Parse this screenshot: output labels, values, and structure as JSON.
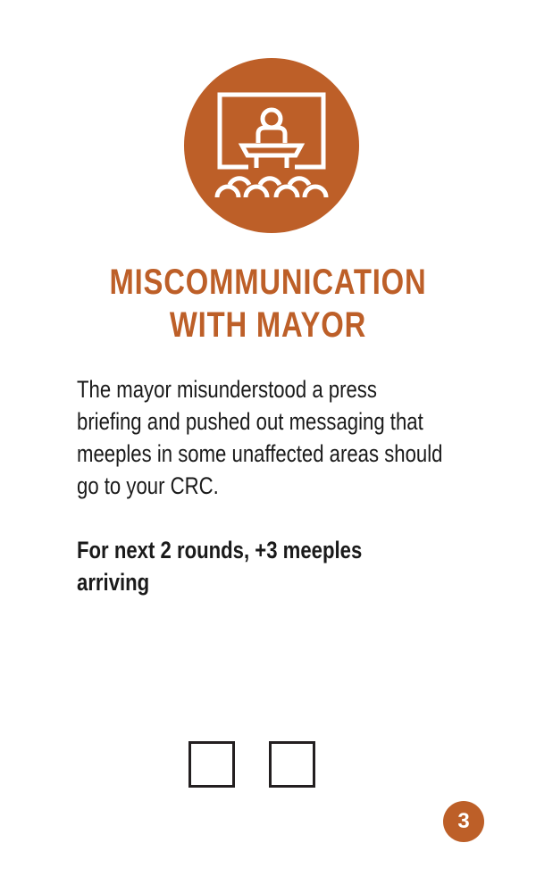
{
  "card": {
    "icon": "press-briefing-podium-icon",
    "title_line1": "MISCOMMUNICATION",
    "title_line2": "WITH MAYOR",
    "description": "The mayor misunderstood a press briefing and pushed out messaging that meeples in some unaffected areas should go to your CRC.",
    "effect": "For next 2 rounds, +3 meeples arriving",
    "round_checkboxes": 2,
    "number": "3",
    "accent_color": "#bd5f28"
  }
}
